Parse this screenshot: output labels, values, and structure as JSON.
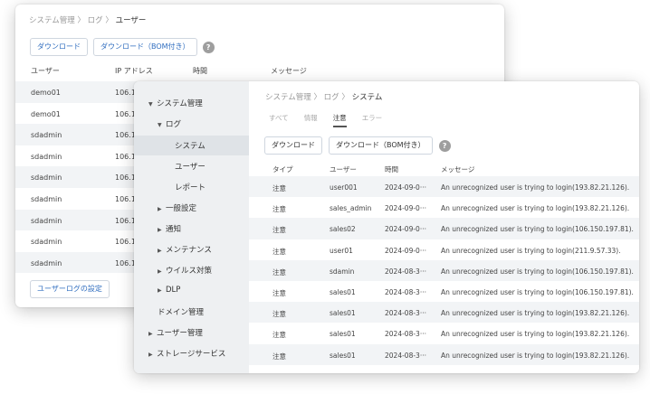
{
  "back_window": {
    "breadcrumb": [
      "システム管理",
      "ログ",
      "ユーザー"
    ],
    "buttons": {
      "download": "ダウンロード",
      "download_bom": "ダウンロード（BOM付き）"
    },
    "help": "?",
    "columns": [
      "ユーザー",
      "IP アドレス",
      "時間",
      "メッセージ"
    ],
    "rows": [
      {
        "user": "demo01",
        "ip": "106.1"
      },
      {
        "user": "demo01",
        "ip": "106.1"
      },
      {
        "user": "sdadmin",
        "ip": "106.1"
      },
      {
        "user": "sdadmin",
        "ip": "106.1"
      },
      {
        "user": "sdadmin",
        "ip": "106.1"
      },
      {
        "user": "sdadmin",
        "ip": "106.1"
      },
      {
        "user": "sdadmin",
        "ip": "106.1"
      },
      {
        "user": "sdadmin",
        "ip": "106.1"
      },
      {
        "user": "sdadmin",
        "ip": "106.1"
      }
    ],
    "footer_button": "ユーザーログの設定"
  },
  "front_window": {
    "sidebar": {
      "system_admin": "システム管理",
      "log": "ログ",
      "system": "システム",
      "user": "ユーザー",
      "report": "レポート",
      "general": "一般設定",
      "notify": "通知",
      "maintenance": "メンテナンス",
      "antivirus": "ウイルス対策",
      "dlp": "DLP",
      "domain": "ドメイン管理",
      "user_admin": "ユーザー管理",
      "storage": "ストレージサービス"
    },
    "breadcrumb": [
      "システム管理",
      "ログ",
      "システム"
    ],
    "tabs": [
      "すべて",
      "情報",
      "注意",
      "エラー"
    ],
    "buttons": {
      "download": "ダウンロード",
      "download_bom": "ダウンロード（BOM付き）"
    },
    "help": "?",
    "columns": [
      "タイプ",
      "ユーザー",
      "時間",
      "メッセージ"
    ],
    "rows": [
      {
        "type": "注意",
        "user": "user001",
        "time": "2024-09-0···",
        "message": "An unrecognized user is trying to login(193.82.21.126)."
      },
      {
        "type": "注意",
        "user": "sales_admin",
        "time": "2024-09-0···",
        "message": "An unrecognized user is trying to login(193.82.21.126)."
      },
      {
        "type": "注意",
        "user": "sales02",
        "time": "2024-09-0···",
        "message": "An unrecognized user is trying to login(106.150.197.81)."
      },
      {
        "type": "注意",
        "user": "user01",
        "time": "2024-09-0···",
        "message": "An unrecognized user is trying to login(211.9.57.33)."
      },
      {
        "type": "注意",
        "user": "sdamin",
        "time": "2024-08-3···",
        "message": "An unrecognized user is trying to login(106.150.197.81)."
      },
      {
        "type": "注意",
        "user": "sales01",
        "time": "2024-08-3···",
        "message": "An unrecognized user is trying to login(106.150.197.81)."
      },
      {
        "type": "注意",
        "user": "sales01",
        "time": "2024-08-3···",
        "message": "An unrecognized user is trying to login(193.82.21.126)."
      },
      {
        "type": "注意",
        "user": "sales01",
        "time": "2024-08-3···",
        "message": "An unrecognized user is trying to login(193.82.21.126)."
      },
      {
        "type": "注意",
        "user": "sales01",
        "time": "2024-08-3···",
        "message": "An unrecognized user is trying to login(193.82.21.126)."
      }
    ]
  }
}
